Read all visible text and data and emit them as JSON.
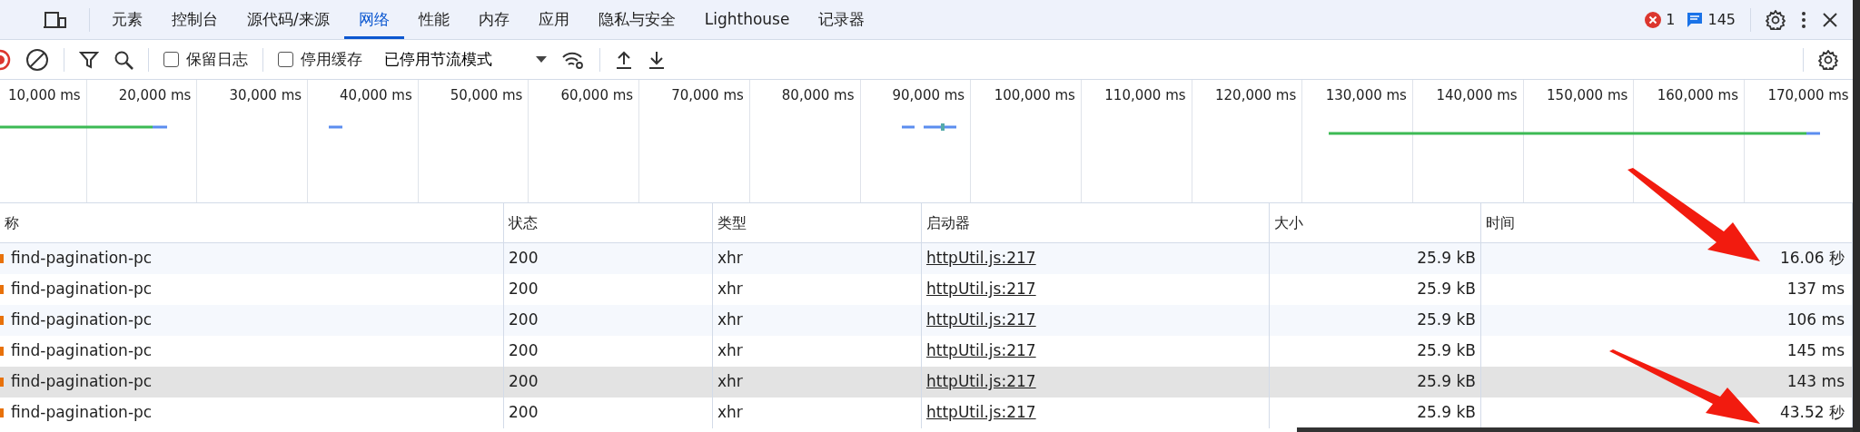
{
  "tabs": [
    {
      "label": "元素",
      "selected": false
    },
    {
      "label": "控制台",
      "selected": false
    },
    {
      "label": "源代码/来源",
      "selected": false
    },
    {
      "label": "网络",
      "selected": true
    },
    {
      "label": "性能",
      "selected": false
    },
    {
      "label": "内存",
      "selected": false
    },
    {
      "label": "应用",
      "selected": false
    },
    {
      "label": "隐私与安全",
      "selected": false
    },
    {
      "label": "Lighthouse",
      "selected": false
    },
    {
      "label": "记录器",
      "selected": false
    }
  ],
  "status": {
    "errors": "1",
    "messages": "145"
  },
  "toolbar": {
    "preserve_log": {
      "label": "保留日志",
      "checked": false
    },
    "disable_cache": {
      "label": "停用缓存",
      "checked": false
    },
    "throttling": "已停用节流模式"
  },
  "timeline": {
    "ticks": [
      "10,000 ms",
      "20,000 ms",
      "30,000 ms",
      "40,000 ms",
      "50,000 ms",
      "60,000 ms",
      "70,000 ms",
      "80,000 ms",
      "90,000 ms",
      "100,000 ms",
      "110,000 ms",
      "120,000 ms",
      "130,000 ms",
      "140,000 ms",
      "150,000 ms",
      "160,000 ms",
      "170,000 ms"
    ]
  },
  "table": {
    "columns": [
      "称",
      "状态",
      "类型",
      "启动器",
      "大小",
      "时间"
    ],
    "rows": [
      {
        "name": "find-pagination-pc",
        "status": "200",
        "type": "xhr",
        "initiator": "httpUtil.js:217",
        "size": "25.9 kB",
        "time": "16.06 秒",
        "selected": false
      },
      {
        "name": "find-pagination-pc",
        "status": "200",
        "type": "xhr",
        "initiator": "httpUtil.js:217",
        "size": "25.9 kB",
        "time": "137 ms",
        "selected": false
      },
      {
        "name": "find-pagination-pc",
        "status": "200",
        "type": "xhr",
        "initiator": "httpUtil.js:217",
        "size": "25.9 kB",
        "time": "106 ms",
        "selected": false
      },
      {
        "name": "find-pagination-pc",
        "status": "200",
        "type": "xhr",
        "initiator": "httpUtil.js:217",
        "size": "25.9 kB",
        "time": "145 ms",
        "selected": false
      },
      {
        "name": "find-pagination-pc",
        "status": "200",
        "type": "xhr",
        "initiator": "httpUtil.js:217",
        "size": "25.9 kB",
        "time": "143 ms",
        "selected": true
      },
      {
        "name": "find-pagination-pc",
        "status": "200",
        "type": "xhr",
        "initiator": "httpUtil.js:217",
        "size": "25.9 kB",
        "time": "43.52 秒",
        "selected": false
      }
    ]
  }
}
